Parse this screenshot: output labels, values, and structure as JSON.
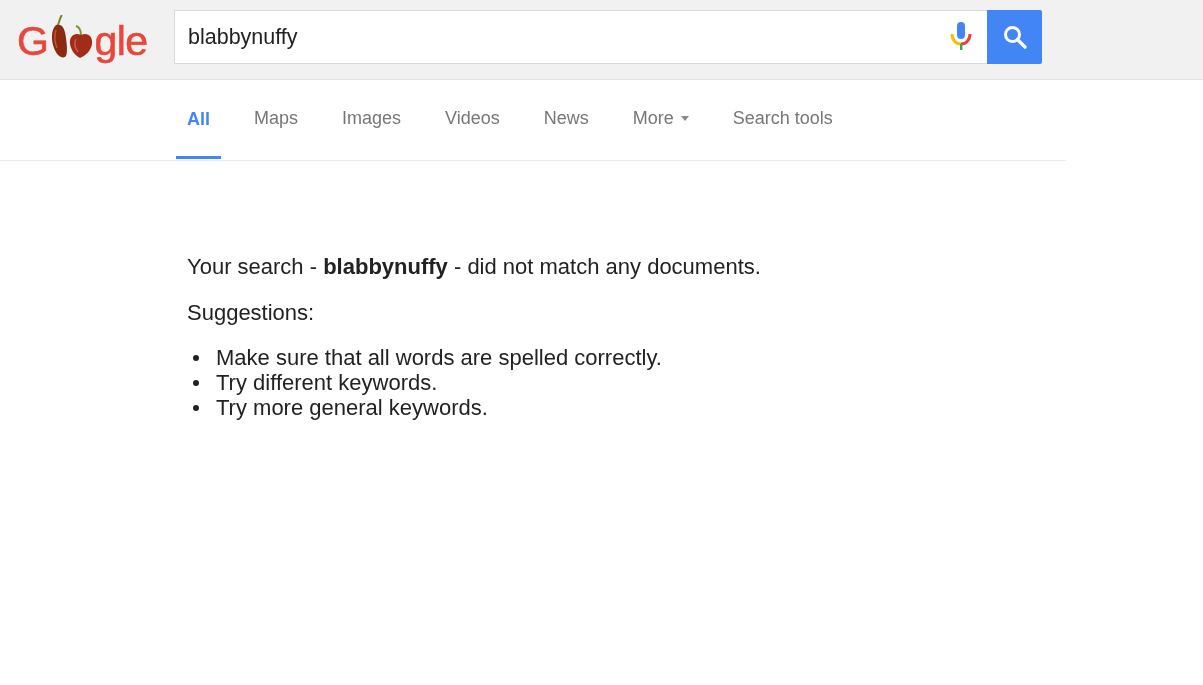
{
  "logo": {
    "text_before": "G",
    "text_after": "gle"
  },
  "search": {
    "value": "blabbynuffy"
  },
  "tabs": [
    {
      "label": "All",
      "selected": true,
      "has_menu": false
    },
    {
      "label": "Maps",
      "selected": false,
      "has_menu": false
    },
    {
      "label": "Images",
      "selected": false,
      "has_menu": false
    },
    {
      "label": "Videos",
      "selected": false,
      "has_menu": false
    },
    {
      "label": "News",
      "selected": false,
      "has_menu": false
    },
    {
      "label": "More",
      "selected": false,
      "has_menu": true
    },
    {
      "label": "Search tools",
      "selected": false,
      "has_menu": false
    }
  ],
  "results": {
    "message": "Your search - **blabbynuffy** - did not match any documents.",
    "suggestions_heading": "Suggestions:",
    "suggestions": [
      "Make sure that all words are spelled correctly.",
      "Try different keywords.",
      "Try more general keywords."
    ]
  }
}
